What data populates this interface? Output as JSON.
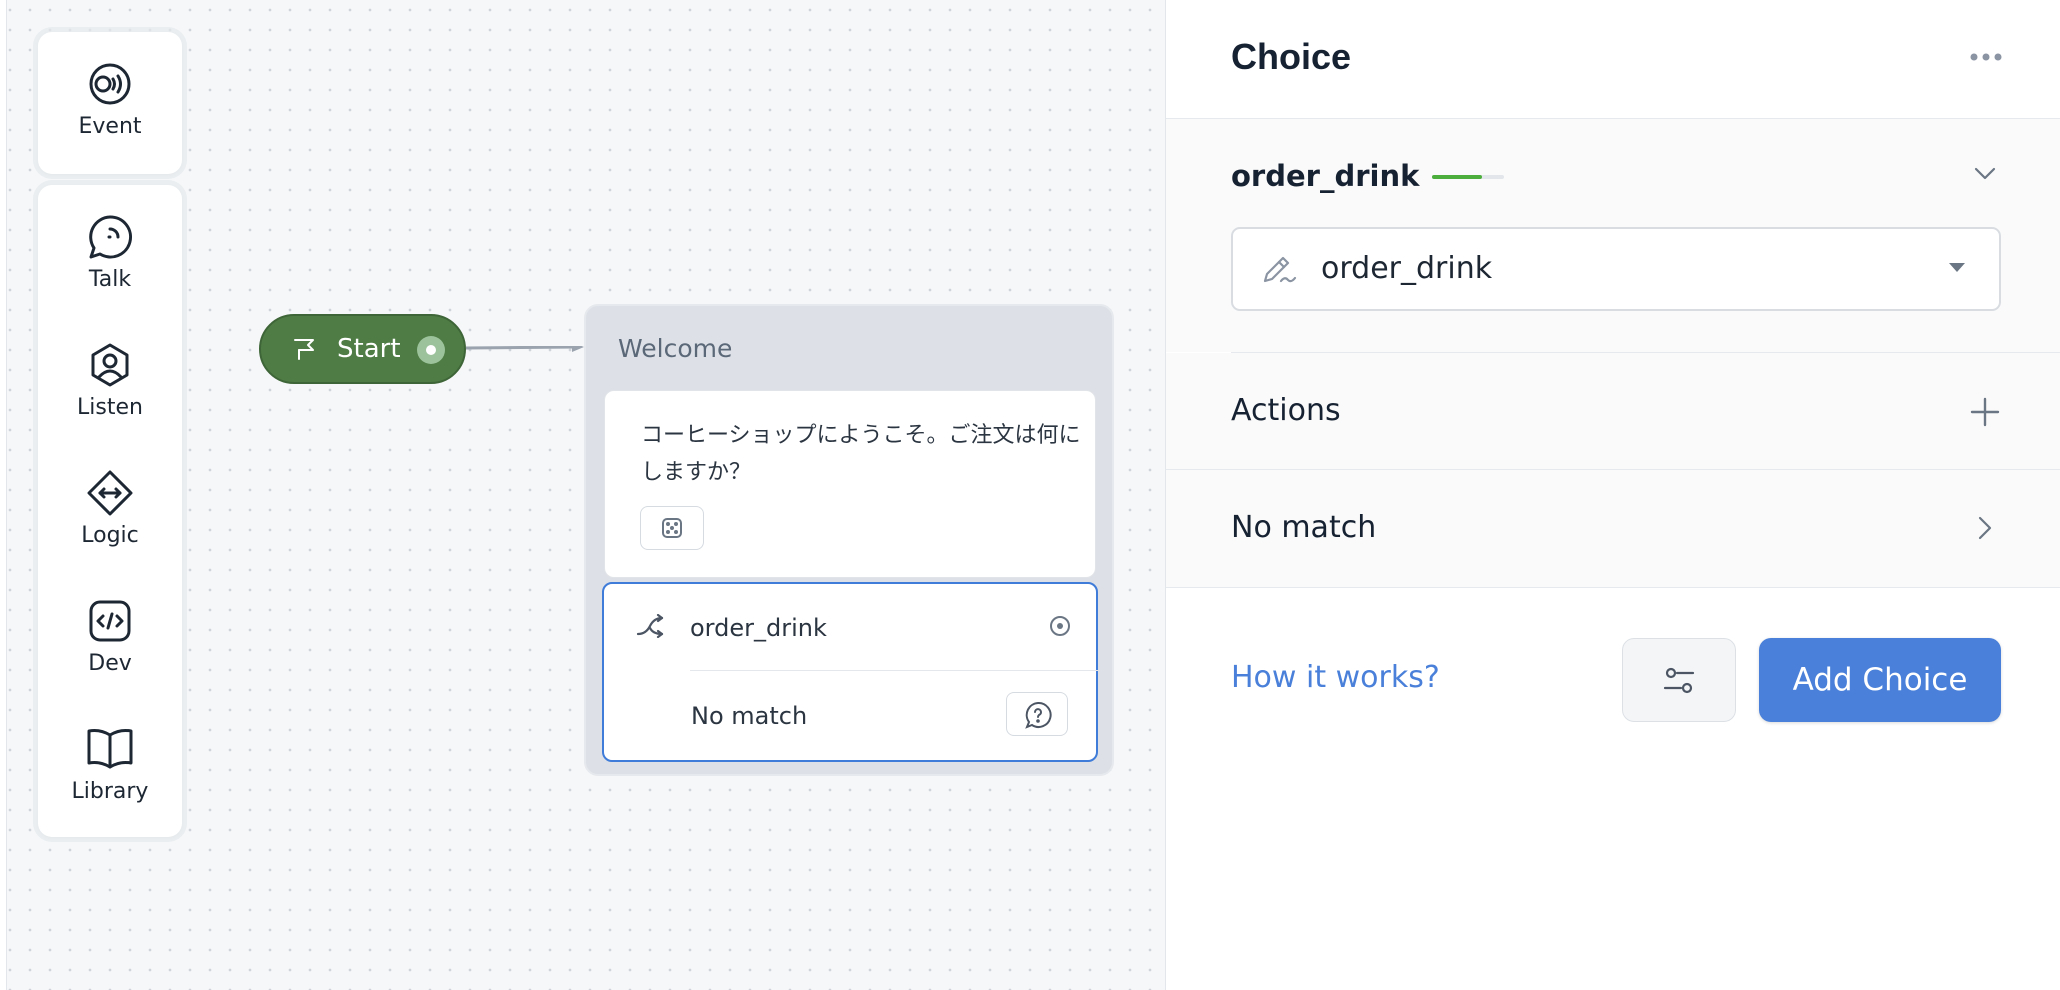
{
  "toolbar": {
    "event": {
      "label": "Event",
      "icon": "event-broadcast-icon"
    },
    "items": [
      {
        "label": "Talk",
        "icon": "chat-bubble-icon"
      },
      {
        "label": "Listen",
        "icon": "listen-user-icon"
      },
      {
        "label": "Logic",
        "icon": "logic-diamond-icon"
      },
      {
        "label": "Dev",
        "icon": "code-icon"
      },
      {
        "label": "Library",
        "icon": "book-icon"
      }
    ]
  },
  "canvas": {
    "start_node": {
      "label": "Start",
      "color": "#4f7c45"
    },
    "block": {
      "title": "Welcome",
      "speak_text": "コーヒーショップにようこそ。ご注文は何にしますか？",
      "choice": {
        "intent": "order_drink",
        "no_match": "No match"
      }
    }
  },
  "panel": {
    "title": "Choice",
    "intent": {
      "name": "order_drink",
      "selected_value": "order_drink",
      "training_progress": 0.7,
      "progress_color": "#4caf3d"
    },
    "actions_label": "Actions",
    "no_match_label": "No match",
    "how_it_works": "How it works?",
    "add_choice": "Add Choice",
    "accent_color": "#4a80d9"
  }
}
